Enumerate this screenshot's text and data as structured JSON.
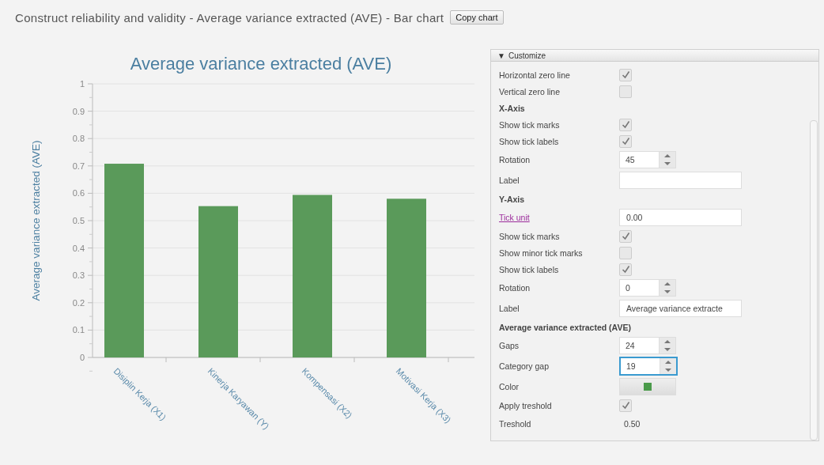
{
  "header": {
    "title": "Construct reliability and validity - Average variance extracted (AVE) - Bar chart",
    "copy_button": "Copy chart"
  },
  "chart": {
    "chart_data": {
      "type": "bar",
      "title": "Average variance extracted (AVE)",
      "ylabel": "Average variance extracted (AVE)",
      "categories": [
        "Disiplin Kerja (X1)",
        "Kinerja Karyawan (Y)",
        "Kompensasi (X2)",
        "Motivasi Kerja (X3)"
      ],
      "grid": {
        "horizontal": true
      },
      "series": [
        {
          "color": "#5a9a5a",
          "values": [
            0.708,
            0.553,
            0.594,
            0.58
          ]
        }
      ],
      "ylim": [
        0,
        1
      ],
      "yticks": [
        {
          "value": 0,
          "label": "0"
        },
        {
          "value": 0.1,
          "label": "0.1"
        },
        {
          "value": 0.2,
          "label": "0.2"
        },
        {
          "value": 0.3,
          "label": "0.3"
        },
        {
          "value": 0.4,
          "label": "0.4"
        },
        {
          "value": 0.5,
          "label": "0.5"
        },
        {
          "value": 0.6,
          "label": "0.6"
        },
        {
          "value": 0.7,
          "label": "0.7"
        },
        {
          "value": 0.8,
          "label": "0.8"
        },
        {
          "value": 0.9,
          "label": "0.9"
        },
        {
          "value": 1,
          "label": "1"
        }
      ]
    }
  },
  "customize": {
    "toggle": "▼",
    "title": "Customize",
    "rows": [
      {
        "kind": "checkbox",
        "label": "Horizontal zero line",
        "checked": true
      },
      {
        "kind": "checkbox",
        "label": "Vertical zero line",
        "checked": false
      },
      {
        "kind": "heading",
        "label": "X-Axis"
      },
      {
        "kind": "checkbox",
        "label": "Show tick marks",
        "checked": true
      },
      {
        "kind": "checkbox",
        "label": "Show tick labels",
        "checked": true
      },
      {
        "kind": "spinner",
        "label": "Rotation",
        "value": "45",
        "focused": false
      },
      {
        "kind": "text",
        "label": "Label"
      },
      {
        "kind": "heading",
        "label": "Y-Axis"
      },
      {
        "kind": "link",
        "label": "Tick unit",
        "value": "0.00"
      },
      {
        "kind": "checkbox",
        "label": "Show tick marks",
        "checked": true
      },
      {
        "kind": "checkbox",
        "label": "Show minor tick marks",
        "checked": false
      },
      {
        "kind": "checkbox",
        "label": "Show tick labels",
        "checked": true
      },
      {
        "kind": "spinner",
        "label": "Rotation",
        "value": "0",
        "focused": false
      },
      {
        "kind": "text",
        "label": "Label",
        "value": "Average variance extracte"
      },
      {
        "kind": "heading",
        "label": "Average variance extracted (AVE)"
      },
      {
        "kind": "spinner",
        "label": "Gaps",
        "value": "24",
        "focused": false
      },
      {
        "kind": "spinner",
        "label": "Category gap",
        "value": "19",
        "focused": true
      },
      {
        "kind": "color",
        "label": "Color",
        "color": "#4a9a4a"
      },
      {
        "kind": "checkbox",
        "label": "Apply treshold",
        "checked": true
      },
      {
        "kind": "plain",
        "label": "Treshold",
        "value": "0.50"
      }
    ]
  }
}
